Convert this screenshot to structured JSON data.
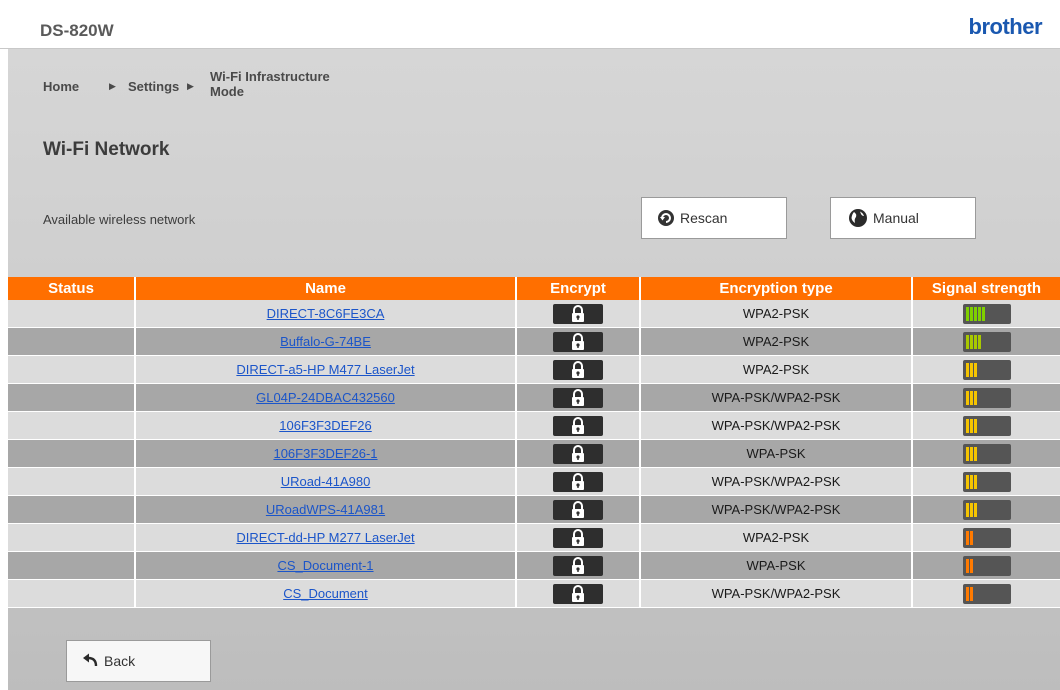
{
  "header": {
    "model": "DS-820W",
    "brand": "brother"
  },
  "breadcrumb": {
    "home": "Home",
    "settings": "Settings",
    "current_line1": "Wi-Fi Infrastructure",
    "current_line2": "Mode"
  },
  "page_title": "Wi-Fi Network",
  "available_label": "Available wireless network",
  "buttons": {
    "rescan": "Rescan",
    "manual": "Manual",
    "back": "Back"
  },
  "table": {
    "columns": [
      "Status",
      "Name",
      "Encrypt",
      "Encryption type",
      "Signal strength"
    ],
    "rows": [
      {
        "status": "",
        "name": "DIRECT-8C6FE3CA",
        "encrypted": true,
        "encryption_type": "WPA2-PSK",
        "signal": 5,
        "signal_color": "#7fd000"
      },
      {
        "status": "",
        "name": "Buffalo-G-74BE",
        "encrypted": true,
        "encryption_type": "WPA2-PSK",
        "signal": 4,
        "signal_color": "#a8c800"
      },
      {
        "status": "",
        "name": "DIRECT-a5-HP M477 LaserJet",
        "encrypted": true,
        "encryption_type": "WPA2-PSK",
        "signal": 3,
        "signal_color": "#f5c400"
      },
      {
        "status": "",
        "name": "GL04P-24DBAC432560",
        "encrypted": true,
        "encryption_type": "WPA-PSK/WPA2-PSK",
        "signal": 3,
        "signal_color": "#f5c400"
      },
      {
        "status": "",
        "name": "106F3F3DEF26",
        "encrypted": true,
        "encryption_type": "WPA-PSK/WPA2-PSK",
        "signal": 3,
        "signal_color": "#f5c400"
      },
      {
        "status": "",
        "name": "106F3F3DEF26-1",
        "encrypted": true,
        "encryption_type": "WPA-PSK",
        "signal": 3,
        "signal_color": "#f5c400"
      },
      {
        "status": "",
        "name": "URoad-41A980",
        "encrypted": true,
        "encryption_type": "WPA-PSK/WPA2-PSK",
        "signal": 3,
        "signal_color": "#f5c400"
      },
      {
        "status": "",
        "name": "URoadWPS-41A981",
        "encrypted": true,
        "encryption_type": "WPA-PSK/WPA2-PSK",
        "signal": 3,
        "signal_color": "#f5c400"
      },
      {
        "status": "",
        "name": "DIRECT-dd-HP M277 LaserJet",
        "encrypted": true,
        "encryption_type": "WPA2-PSK",
        "signal": 2,
        "signal_color": "#ff7a00"
      },
      {
        "status": "",
        "name": "CS_Document-1",
        "encrypted": true,
        "encryption_type": "WPA-PSK",
        "signal": 2,
        "signal_color": "#ff7a00"
      },
      {
        "status": "",
        "name": "CS_Document",
        "encrypted": true,
        "encryption_type": "WPA-PSK/WPA2-PSK",
        "signal": 2,
        "signal_color": "#ff7a00"
      }
    ]
  },
  "icons": {
    "rescan": "refresh-icon",
    "manual": "globe-icon",
    "back": "back-arrow-icon",
    "lock": "lock-icon",
    "signal": "signal-strength-icon"
  },
  "colors": {
    "accent": "#ff6f00",
    "link": "#1b55c9",
    "brand": "#1a58b0"
  }
}
